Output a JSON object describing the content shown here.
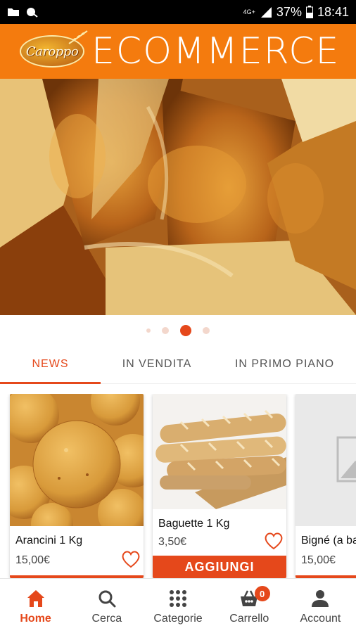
{
  "status_bar": {
    "network": "4G+",
    "battery": "37%",
    "time": "18:41"
  },
  "header": {
    "logo_text": "Caroppo",
    "title": "ECOMMERCE",
    "color": "#f47b0e"
  },
  "banner": {
    "slide_count": 4,
    "active_index": 2
  },
  "tabs": [
    {
      "label": "NEWS",
      "active": true
    },
    {
      "label": "IN VENDITA",
      "active": false
    },
    {
      "label": "IN PRIMO PIANO",
      "active": false
    }
  ],
  "products": [
    {
      "name": "Arancini 1 Kg",
      "price": "15,00€",
      "image": "arancini-image",
      "add_visible": false
    },
    {
      "name": "Baguette 1 Kg",
      "price": "3,50€",
      "image": "baguette-image",
      "add_visible": true,
      "add_label": "AGGIUNGI"
    },
    {
      "name": "Bigné (a ba",
      "price": "15,00€",
      "image": "placeholder-image",
      "add_visible": false
    }
  ],
  "bottom_nav": [
    {
      "label": "Home",
      "icon": "home-icon",
      "active": true
    },
    {
      "label": "Cerca",
      "icon": "search-icon",
      "active": false
    },
    {
      "label": "Categorie",
      "icon": "grid-icon",
      "active": false
    },
    {
      "label": "Carrello",
      "icon": "cart-icon",
      "active": false,
      "badge": "0"
    },
    {
      "label": "Account",
      "icon": "account-icon",
      "active": false
    }
  ],
  "accent_color": "#e5481b"
}
